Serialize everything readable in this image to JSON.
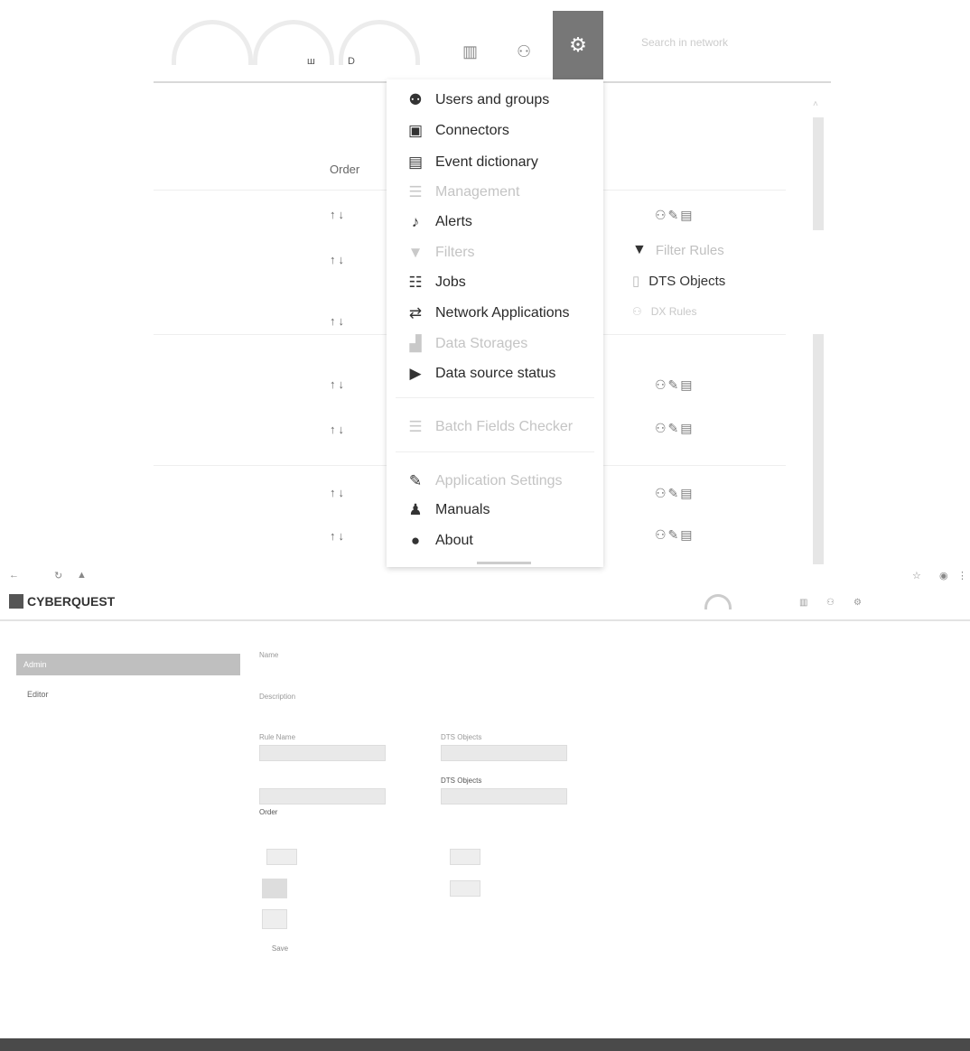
{
  "toolbar": {
    "gauge_label_1": "ш",
    "gauge_label_2": "D",
    "search_placeholder": "Search in network"
  },
  "settings_menu": {
    "items": [
      {
        "label": "Users and groups",
        "icon": "users-icon",
        "enabled": true
      },
      {
        "label": "Connectors",
        "icon": "connector-icon",
        "enabled": true
      },
      {
        "label": "Event dictionary",
        "icon": "book-icon",
        "enabled": true
      },
      {
        "label": "Management",
        "icon": "list-icon",
        "enabled": false
      },
      {
        "label": "Alerts",
        "icon": "bell-icon",
        "enabled": true
      },
      {
        "label": "Filters",
        "icon": "filter-icon",
        "enabled": false
      },
      {
        "label": "Jobs",
        "icon": "tasks-icon",
        "enabled": true
      },
      {
        "label": "Network Applications",
        "icon": "exchange-icon",
        "enabled": true
      },
      {
        "label": "Data Storages",
        "icon": "storage-icon",
        "enabled": false
      },
      {
        "label": "Data source status",
        "icon": "play-circle-icon",
        "enabled": true
      },
      {
        "label": "Batch Fields Checker",
        "icon": "database-icon",
        "enabled": false
      },
      {
        "label": "Application Settings",
        "icon": "wrench-icon",
        "enabled": false
      },
      {
        "label": "Manuals",
        "icon": "reader-icon",
        "enabled": true
      },
      {
        "label": "About",
        "icon": "info-globe-icon",
        "enabled": true
      }
    ]
  },
  "side_items": {
    "filter_rules": "Filter Rules",
    "dts_objects": "DTS Objects",
    "dx_rules": "DX Rules"
  },
  "table": {
    "order_header": "Order"
  },
  "lower": {
    "brand": "CYBERQUEST",
    "nav_active": "Admin",
    "nav_item": "Editor",
    "form": {
      "field_name": "Name",
      "field_description": "Description",
      "field_left": "Rule Name",
      "field_right": "DTS Objects",
      "dts_objects_label": "DTS Objects",
      "order_label": "Order",
      "button_save": "Save"
    }
  }
}
